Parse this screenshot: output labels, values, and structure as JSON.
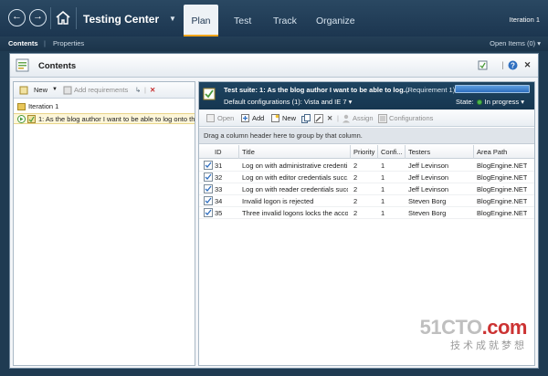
{
  "app": {
    "title": "Testing Center",
    "tabs": [
      {
        "label": "Plan"
      },
      {
        "label": "Test"
      },
      {
        "label": "Track"
      },
      {
        "label": "Organize"
      }
    ],
    "iteration": "Iteration 1"
  },
  "subnav": {
    "items": [
      "Contents",
      "Properties"
    ],
    "separator": "|",
    "open_items": "Open Items (0)"
  },
  "window": {
    "title": "Contents"
  },
  "left": {
    "toolbar": {
      "new_label": "New",
      "add_requirements_label": "Add requirements"
    },
    "tree": [
      {
        "label": "Iteration 1"
      },
      {
        "label": "1: As the blog author I want to be able to log onto th"
      }
    ]
  },
  "suite": {
    "title": "Test suite:  1: As the blog author I want to be able to log...",
    "requirement": "(Requirement 1)",
    "configurations": "Default configurations (1):  Vista and IE 7",
    "state_label": "State:",
    "state_value": "In progress"
  },
  "right_toolbar": {
    "open": "Open",
    "add": "Add",
    "new": "New",
    "assign": "Assign",
    "configurations": "Configurations"
  },
  "grid": {
    "group_hint": "Drag a column header here to group by that column.",
    "columns": [
      "ID",
      "Title",
      "Priority",
      "Confi...",
      "Testers",
      "Area Path"
    ],
    "rows": [
      {
        "id": "31",
        "title": "Log on with administrative credenti...",
        "priority": "2",
        "config": "1",
        "tester": "Jeff Levinson",
        "area": "BlogEngine.NET"
      },
      {
        "id": "32",
        "title": "Log on with editor credentials succ...",
        "priority": "2",
        "config": "1",
        "tester": "Jeff Levinson",
        "area": "BlogEngine.NET"
      },
      {
        "id": "33",
        "title": "Log on with reader credentials succ...",
        "priority": "2",
        "config": "1",
        "tester": "Jeff Levinson",
        "area": "BlogEngine.NET"
      },
      {
        "id": "34",
        "title": "Invalid logon is rejected",
        "priority": "2",
        "config": "1",
        "tester": "Steven Borg",
        "area": "BlogEngine.NET"
      },
      {
        "id": "35",
        "title": "Three invalid logons locks the acco...",
        "priority": "2",
        "config": "1",
        "tester": "Steven Borg",
        "area": "BlogEngine.NET"
      }
    ]
  },
  "watermark": {
    "logo_main": "51CTO",
    "logo_suffix": ".com",
    "tagline": "技术成就梦想"
  },
  "colors": {
    "topbar": "#1f3b52",
    "accent_tab_underline": "#f2a51a",
    "suite_header": "#1e4461",
    "selected_row": "#fdf6d9"
  }
}
